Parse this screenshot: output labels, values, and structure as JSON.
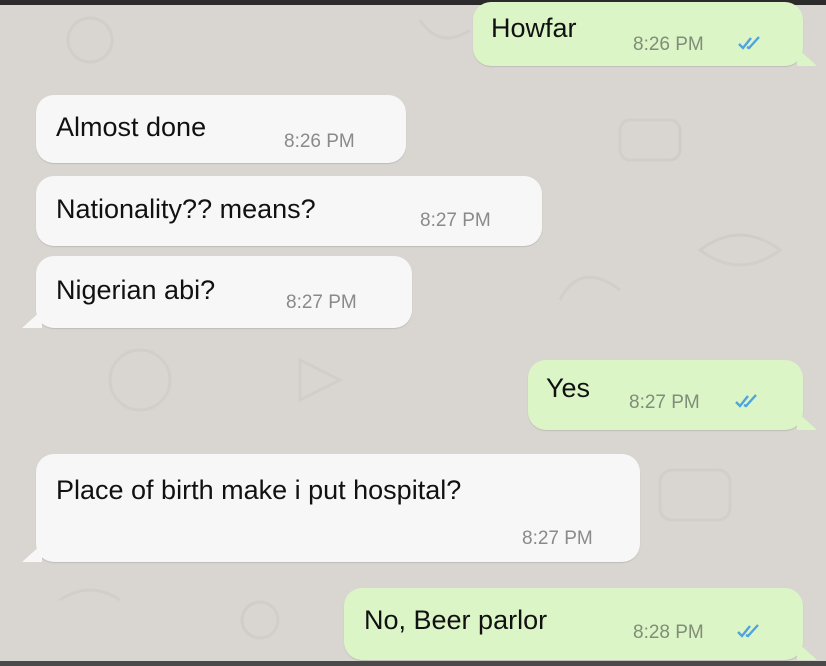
{
  "colors": {
    "background": "#d9d6d1",
    "incoming_bubble": "#f7f7f7",
    "outgoing_bubble": "#dcf5c6",
    "read_ticks": "#4fa3e0"
  },
  "messages": [
    {
      "direction": "outgoing",
      "text": "Howfar",
      "time": "8:26 PM",
      "status_icon": "double-check-read-icon"
    },
    {
      "direction": "incoming",
      "text": "Almost done",
      "time": "8:26 PM"
    },
    {
      "direction": "incoming",
      "text": "Nationality?? means?",
      "time": "8:27 PM"
    },
    {
      "direction": "incoming",
      "text": "Nigerian abi?",
      "time": "8:27 PM"
    },
    {
      "direction": "outgoing",
      "text": "Yes",
      "time": "8:27 PM",
      "status_icon": "double-check-read-icon"
    },
    {
      "direction": "incoming",
      "text": "Place of birth make i put hospital?",
      "time": "8:27 PM"
    },
    {
      "direction": "outgoing",
      "text": "No, Beer parlor",
      "time": "8:28 PM",
      "status_icon": "double-check-read-icon"
    }
  ]
}
